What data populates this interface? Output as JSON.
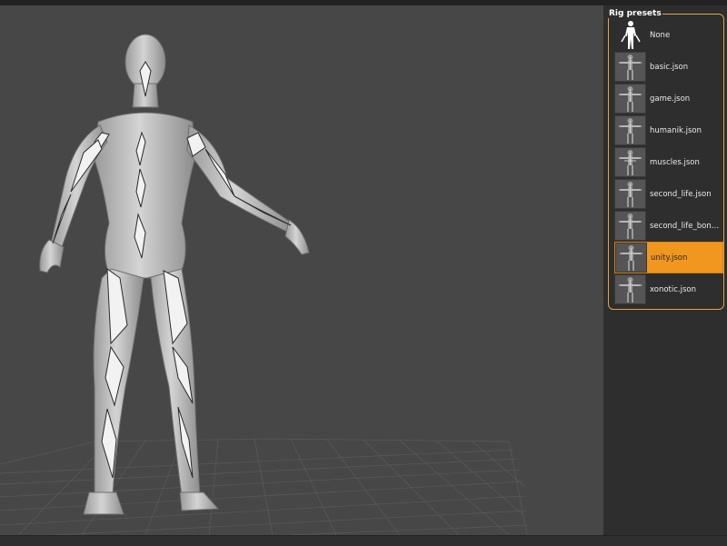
{
  "panel": {
    "title": "Rig presets",
    "presets": [
      {
        "label": "None",
        "thumb": "human-figure-icon"
      },
      {
        "label": "basic.json",
        "thumb": "rig-thumbnail"
      },
      {
        "label": "game.json",
        "thumb": "rig-thumbnail"
      },
      {
        "label": "humanik.json",
        "thumb": "rig-thumbnail"
      },
      {
        "label": "muscles.json",
        "thumb": "rig-thumbnail"
      },
      {
        "label": "second_life.json",
        "thumb": "rig-thumbnail"
      },
      {
        "label": "second_life_bones.json",
        "thumb": "rig-thumbnail"
      },
      {
        "label": "unity.json",
        "thumb": "rig-thumbnail",
        "selected": true
      },
      {
        "label": "xonotic.json",
        "thumb": "rig-thumbnail"
      }
    ]
  },
  "colors": {
    "accent": "#f1961f",
    "viewport_bg": "#474747",
    "panel_bg": "#2e2e2e"
  }
}
